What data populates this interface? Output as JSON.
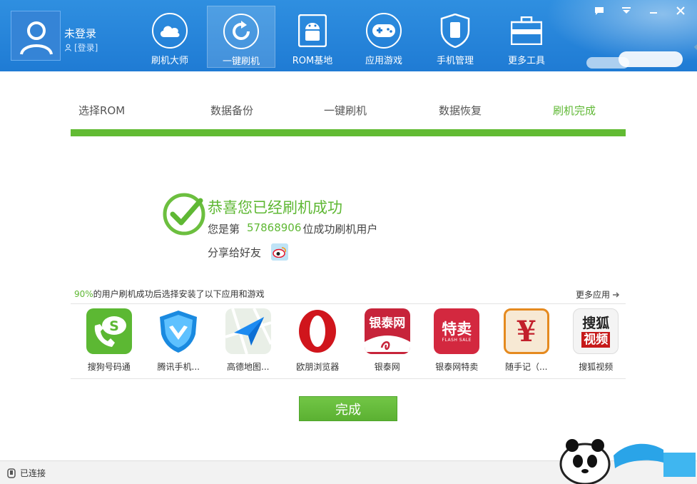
{
  "header": {
    "user_name": "未登录",
    "login_label": "[登录]",
    "nav": [
      {
        "label": "刷机大师",
        "icon": "cloud-icon"
      },
      {
        "label": "一键刷机",
        "icon": "refresh-icon",
        "active": true
      },
      {
        "label": "ROM基地",
        "icon": "android-icon"
      },
      {
        "label": "应用游戏",
        "icon": "gamepad-icon"
      },
      {
        "label": "手机管理",
        "icon": "phone-shield-icon"
      },
      {
        "label": "更多工具",
        "icon": "toolbox-icon"
      }
    ]
  },
  "steps": [
    "选择ROM",
    "数据备份",
    "一键刷机",
    "数据恢复",
    "刷机完成"
  ],
  "success": {
    "title": "恭喜您已经刷机成功",
    "prefix": "您是第",
    "count": "57868906",
    "suffix": "位成功刷机用户",
    "share_label": "分享给好友"
  },
  "recommend": {
    "percent": "90%",
    "text": "的用户刷机成功后选择安装了以下应用和游戏",
    "more_label": "更多应用",
    "apps": [
      {
        "label": "搜狗号码通",
        "icon": "sogou-phone-icon"
      },
      {
        "label": "腾讯手机...",
        "icon": "tencent-shield-icon"
      },
      {
        "label": "高德地图...",
        "icon": "amap-icon"
      },
      {
        "label": "欧朋浏览器",
        "icon": "opera-icon"
      },
      {
        "label": "银泰网",
        "icon": "yintai-icon",
        "icon_text": "银泰网"
      },
      {
        "label": "银泰网特卖",
        "icon": "yintai-sale-icon",
        "icon_text": "特卖",
        "icon_subtext": "FLASH SALE"
      },
      {
        "label": "随手记（...",
        "icon": "yen-icon",
        "icon_text": "¥"
      },
      {
        "label": "搜狐视频",
        "icon": "sohu-video-icon",
        "icon_text": "搜狐",
        "icon_subtext": "视频"
      }
    ]
  },
  "done_label": "完成",
  "status": "已连接",
  "colors": {
    "brand_blue": "#1f7bd4",
    "success_green": "#5fb834"
  }
}
